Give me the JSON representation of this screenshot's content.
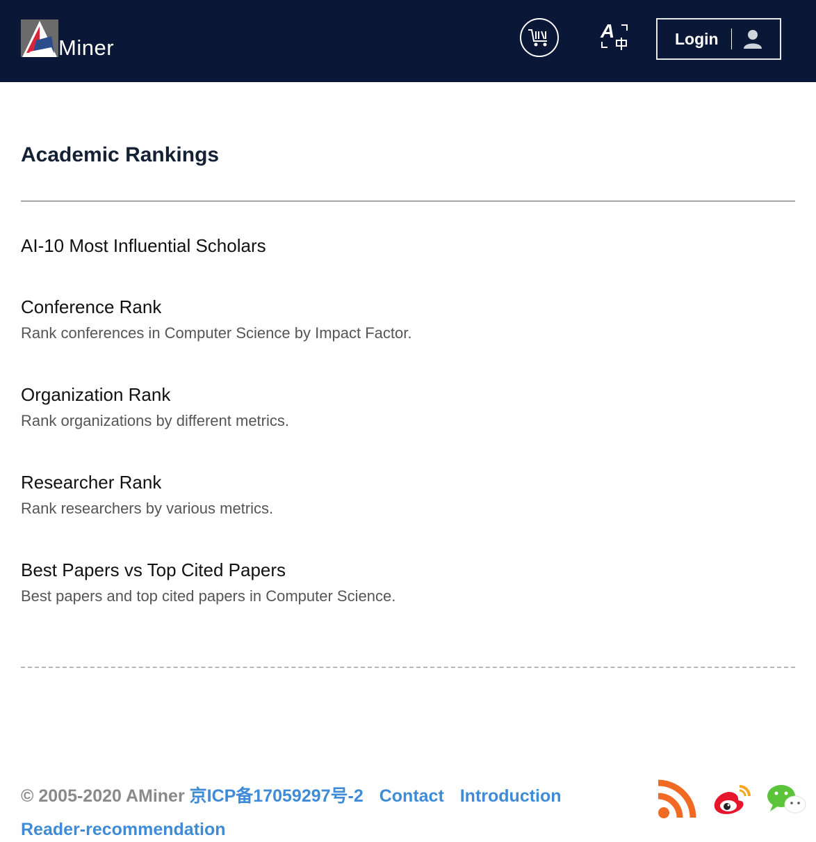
{
  "header": {
    "logo_text": "Miner",
    "login_label": "Login",
    "icons": {
      "cart": "cart-icon",
      "language": "translate-icon",
      "user": "user-icon"
    }
  },
  "main": {
    "title": "Academic Rankings",
    "items": [
      {
        "title": "AI-10 Most Influential Scholars",
        "desc": ""
      },
      {
        "title": "Conference Rank",
        "desc": "Rank conferences in Computer Science by Impact Factor."
      },
      {
        "title": "Organization Rank",
        "desc": "Rank organizations by different metrics."
      },
      {
        "title": "Researcher Rank",
        "desc": "Rank researchers by various metrics."
      },
      {
        "title": "Best Papers vs Top Cited Papers",
        "desc": "Best papers and top cited papers in Computer Science."
      }
    ]
  },
  "footer": {
    "copyright": "© 2005-2020 AMiner",
    "icp": "京ICP备17059297号-2",
    "contact": "Contact",
    "introduction": "Introduction",
    "reader": "Reader-recommendation",
    "social_icons": [
      "rss-icon",
      "weibo-icon",
      "wechat-icon"
    ]
  },
  "colors": {
    "header_bg": "#0b1736",
    "link": "#3f8bd6",
    "rss": "#f06a23",
    "weibo": "#e6162d",
    "wechat": "#5cc43a"
  }
}
